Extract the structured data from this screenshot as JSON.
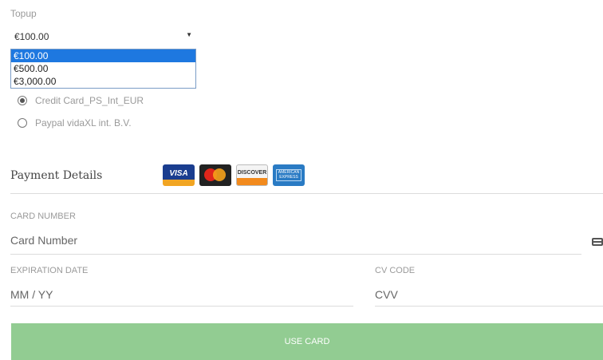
{
  "topup": {
    "label": "Topup",
    "selected_value": "€100.00",
    "options": [
      "€100.00",
      "€500.00",
      "€3,000.00"
    ]
  },
  "payment_methods": [
    {
      "label": "Credit Card_PS_Int_EUR",
      "selected": true
    },
    {
      "label": "Paypal vidaXL int. B.V.",
      "selected": false
    }
  ],
  "payment_details": {
    "title": "Payment Details",
    "card_logos": [
      {
        "icon": "visa-icon",
        "text": "VISA"
      },
      {
        "icon": "mastercard-icon",
        "text": ""
      },
      {
        "icon": "discover-icon",
        "text": "DISCOVER"
      },
      {
        "icon": "amex-icon",
        "text": "AMERICAN EXPRESS"
      }
    ]
  },
  "card_number": {
    "label": "CARD NUMBER",
    "placeholder": "Card Number",
    "icon": "credit-card-icon"
  },
  "expiration": {
    "label": "EXPIRATION DATE",
    "placeholder": "MM / YY"
  },
  "cvc": {
    "label": "CV CODE",
    "placeholder": "CVV"
  },
  "submit": {
    "label": "USE CARD",
    "color": "#92cc92"
  }
}
